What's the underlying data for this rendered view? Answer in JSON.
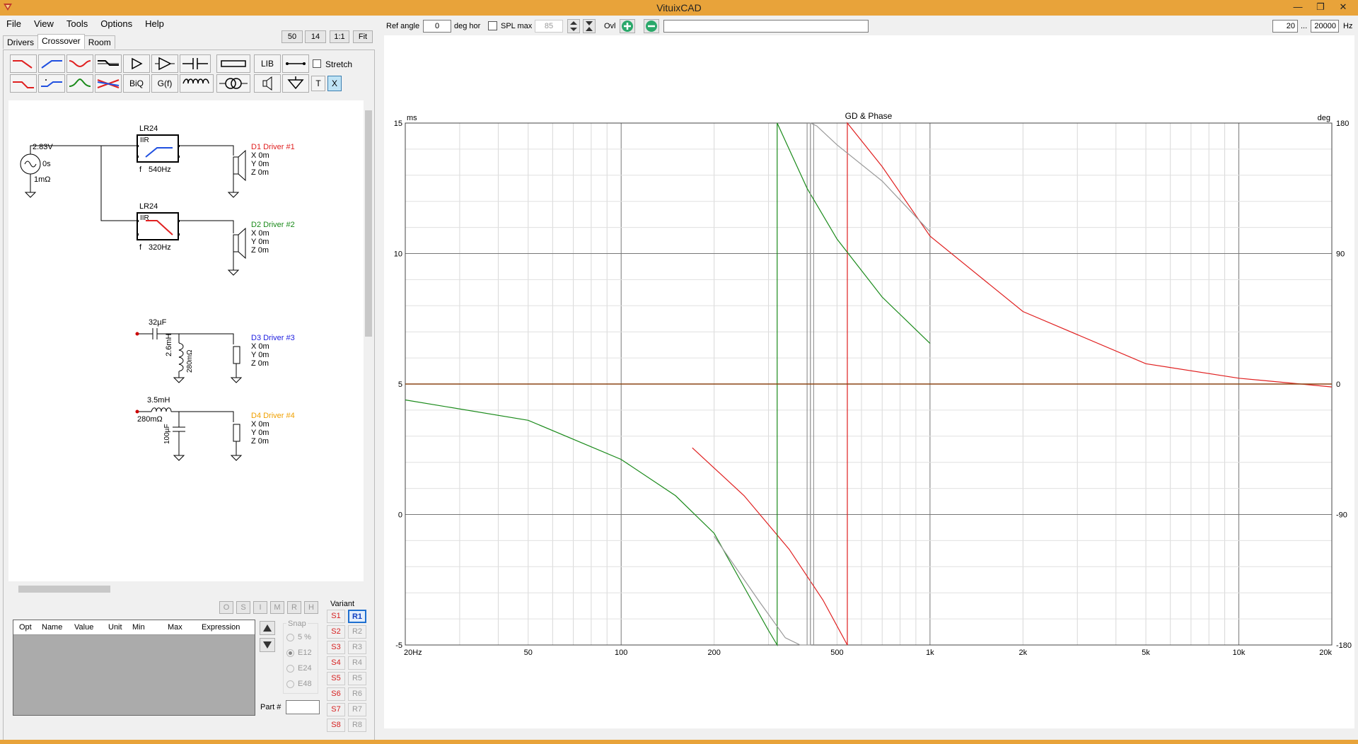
{
  "window": {
    "title": "VituixCAD"
  },
  "menu": [
    "File",
    "View",
    "Tools",
    "Options",
    "Help"
  ],
  "tabs": [
    "Drivers",
    "Crossover",
    "Room"
  ],
  "zoom_buttons": [
    "50",
    "14",
    "1:1",
    "Fit"
  ],
  "toolbar": {
    "stretch_label": "Stretch",
    "lib_label": "LIB",
    "biq_label": "BiQ",
    "gf_label": "G(f)",
    "t_label": "T",
    "x_label": "X"
  },
  "schematic": {
    "source": {
      "voltage": "2.83V",
      "delay": "0s",
      "resistance": "1mΩ"
    },
    "filter1": {
      "type": "LR24",
      "kind": "IIR",
      "freq_label": "f",
      "freq": "540Hz"
    },
    "filter2": {
      "type": "LR24",
      "kind": "IIR",
      "freq_label": "f",
      "freq": "320Hz"
    },
    "drivers": [
      {
        "name": "D1 Driver #1",
        "color": "#e02020",
        "x": "X 0m",
        "y": "Y 0m",
        "z": "Z 0m"
      },
      {
        "name": "D2 Driver #2",
        "color": "#1a8a1a",
        "x": "X 0m",
        "y": "Y 0m",
        "z": "Z 0m"
      },
      {
        "name": "D3 Driver #3",
        "color": "#2020e0",
        "x": "X 0m",
        "y": "Y 0m",
        "z": "Z 0m"
      },
      {
        "name": "D4 Driver #4",
        "color": "#f0a000",
        "x": "X 0m",
        "y": "Y 0m",
        "z": "Z 0m"
      }
    ],
    "d3_parts": {
      "cap": "32µF",
      "ind": "2.6mH",
      "res": "280mΩ"
    },
    "d4_parts": {
      "ind": "3.5mH",
      "res": "280mΩ",
      "cap": "100µF"
    }
  },
  "parts_toolbar": [
    "O",
    "S",
    "I",
    "M",
    "R",
    "H"
  ],
  "parts_table": {
    "columns": [
      "Opt",
      "Name",
      "Value",
      "Unit",
      "Min",
      "Max",
      "Expression"
    ]
  },
  "snap": {
    "label": "Snap",
    "options": [
      "5 %",
      "E12",
      "E24",
      "E48"
    ],
    "selected": "E12"
  },
  "part_number": {
    "label": "Part #",
    "value": ""
  },
  "variant": {
    "label": "Variant",
    "s": [
      "S1",
      "S2",
      "S3",
      "S4",
      "S5",
      "S6",
      "S7",
      "S8"
    ],
    "r": [
      "R1",
      "R2",
      "R3",
      "R4",
      "R5",
      "R6",
      "R7",
      "R8"
    ],
    "active_r": "R1"
  },
  "top_controls": {
    "ref_angle_label": "Ref angle",
    "ref_angle_value": "0",
    "deg_hor_label": "deg hor",
    "spl_max_label": "SPL max",
    "spl_max_value": "85",
    "ovl_label": "Ovl",
    "freq_min": "20",
    "freq_sep": "...",
    "freq_max": "20000",
    "freq_unit": "Hz"
  },
  "colors": {
    "titlebar": "#e8a33a",
    "driver1": "#e02020",
    "driver2": "#1a8a1a",
    "sum": "#999999",
    "reference": "#8b4513"
  },
  "chart_data": {
    "type": "line",
    "title": "GD & Phase",
    "ylabel_left": "ms",
    "ylabel_right": "deg",
    "x_scale": "log",
    "xlim": [
      20,
      20000
    ],
    "ylim_left": [
      -5,
      15
    ],
    "ylim_right": [
      -180,
      180
    ],
    "x_tick_labels": [
      "20Hz",
      "50",
      "100",
      "200",
      "500",
      "1k",
      "2k",
      "5k",
      "10k",
      "20k"
    ],
    "y_left_ticks": [
      "15",
      "10",
      "5",
      "0",
      "-5"
    ],
    "y_right_ticks": [
      "180",
      "90",
      "0",
      "-90",
      "-180"
    ],
    "grid": true,
    "series": [
      {
        "color": "#e02020",
        "axis": "right",
        "x": [
          170,
          250,
          350,
          450,
          540,
          540,
          700,
          1000,
          2000,
          5000,
          10000,
          20000
        ],
        "y": [
          -44,
          -77,
          -114,
          -149,
          -180,
          180,
          150,
          102,
          50,
          14,
          4,
          -2
        ]
      },
      {
        "color": "#1a8a1a",
        "axis": "right",
        "x": [
          20,
          50,
          100,
          150,
          200,
          250,
          300,
          320,
          320,
          400,
          500,
          700,
          1000
        ],
        "y": [
          -11,
          -25,
          -52,
          -77,
          -103,
          -140,
          -170,
          -180,
          180,
          135,
          100,
          60,
          28
        ]
      },
      {
        "color": "#999999",
        "axis": "right",
        "x": [
          200,
          280,
          340,
          380,
          410,
          410,
          430,
          500,
          700,
          1000
        ],
        "y": [
          -105,
          -150,
          -175,
          -180,
          -180,
          180,
          178,
          165,
          140,
          105
        ]
      },
      {
        "color": "#8b4513",
        "axis": "right",
        "x": [
          20,
          20000
        ],
        "y": [
          0,
          0
        ]
      }
    ],
    "vertical_lines": [
      400,
      410,
      420
    ]
  }
}
